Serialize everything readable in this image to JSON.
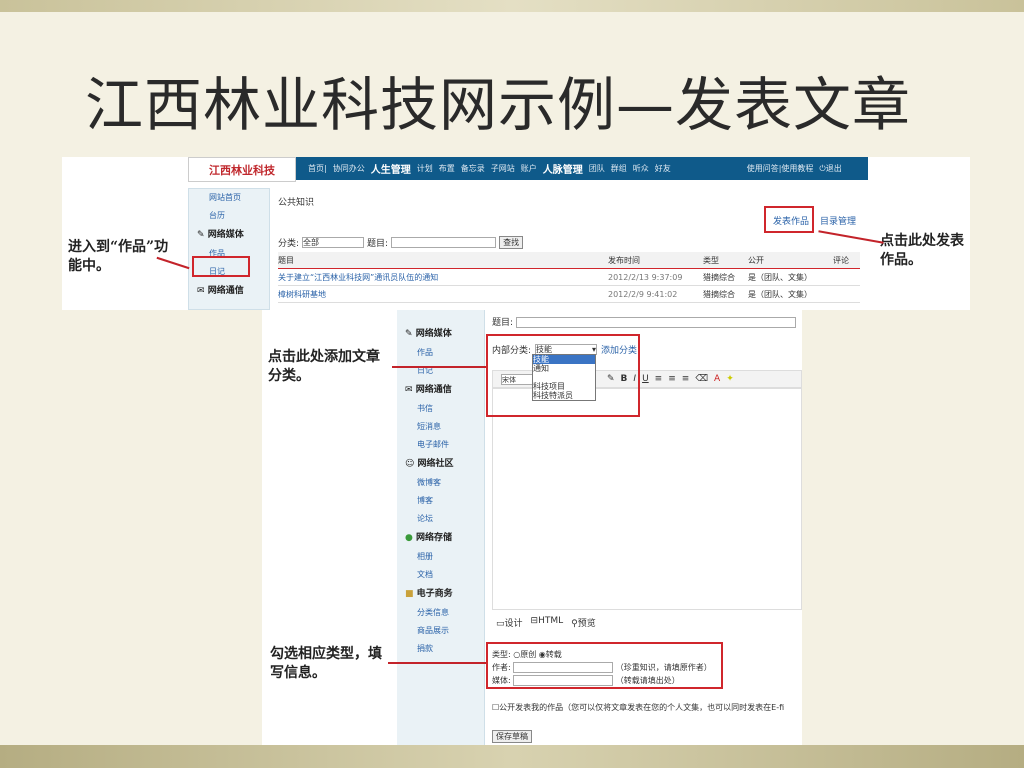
{
  "slide_title": "江西林业科技网示例—发表文章",
  "top": {
    "logo": "江西林业科技",
    "nav_items": [
      "首页|",
      "协同办公",
      "|"
    ],
    "nav_section1": "人生管理",
    "nav_items2": [
      "计划",
      "布置",
      "备忘录",
      "子网站",
      "账户",
      "|"
    ],
    "nav_section2": "人脉管理",
    "nav_items3": [
      "团队",
      "群组",
      "听众",
      "好友"
    ],
    "help": "使用问答|使用教程",
    "logout": "退出",
    "sidebar": {
      "items_top": [
        "网站首页",
        "台历"
      ],
      "section": "网络媒体",
      "items": [
        "作品",
        "日记"
      ],
      "next_section": "网络通信"
    },
    "breadcrumb": "公共知识",
    "publish_link": "发表作品",
    "catalog_link": "目录管理",
    "filter_label": "分类:",
    "filter_value": "全部",
    "title_label": "题目:",
    "search_button": "查找",
    "columns": [
      "题目",
      "发布时间",
      "类型",
      "公开",
      "评论"
    ],
    "rows": [
      {
        "title": "关于建立“江西林业科技网”通讯员队伍的通知",
        "time": "2012/2/13 9:37:09",
        "type": "猎摘综合",
        "public": "是（团队、文集）"
      },
      {
        "title": "樟树科研基地",
        "time": "2012/2/9 9:41:02",
        "type": "猎摘综合",
        "public": "是（团队、文集）"
      }
    ]
  },
  "bottom": {
    "sidebar": [
      {
        "section": "网络媒体",
        "items": [
          "作品",
          "日记"
        ]
      },
      {
        "section": "网络通信",
        "items": [
          "书信",
          "短消息",
          "电子邮件"
        ]
      },
      {
        "section": "网络社区",
        "items": [
          "微博客",
          "博客",
          "论坛"
        ]
      },
      {
        "section": "网络存储",
        "items": [
          "相册",
          "文档"
        ]
      },
      {
        "section": "电子商务",
        "items": [
          "分类信息",
          "商品展示",
          "捐款"
        ]
      }
    ],
    "title_label": "题目:",
    "category_label": "内部分类:",
    "category_value": "技能",
    "add_category": "添加分类",
    "category_options": [
      "技能",
      "通知",
      "",
      "科技项目",
      "科技特派员"
    ],
    "font_value": "宋体",
    "editor_tabs": [
      "设计",
      "HTML",
      "预览"
    ],
    "type_label": "类型:",
    "type_options": [
      "原创",
      "转载"
    ],
    "type_selected": "转载",
    "author_label": "作者:",
    "author_hint": "（珍重知识，请填原作者）",
    "media_label": "媒体:",
    "media_hint": "（转载请填出处）",
    "public_checkbox": "公开发表我的作品（您可以仅将文章发表在您的个人文集，也可以同时发表在E-fi",
    "save_draft": "保存草稿"
  },
  "annotations": {
    "enter_works": "进入到“作品”功能中。",
    "click_publish": "点击此处发表作品。",
    "add_category": "点击此处添加文章分类。",
    "select_type": "勾选相应类型，填写信息。"
  }
}
